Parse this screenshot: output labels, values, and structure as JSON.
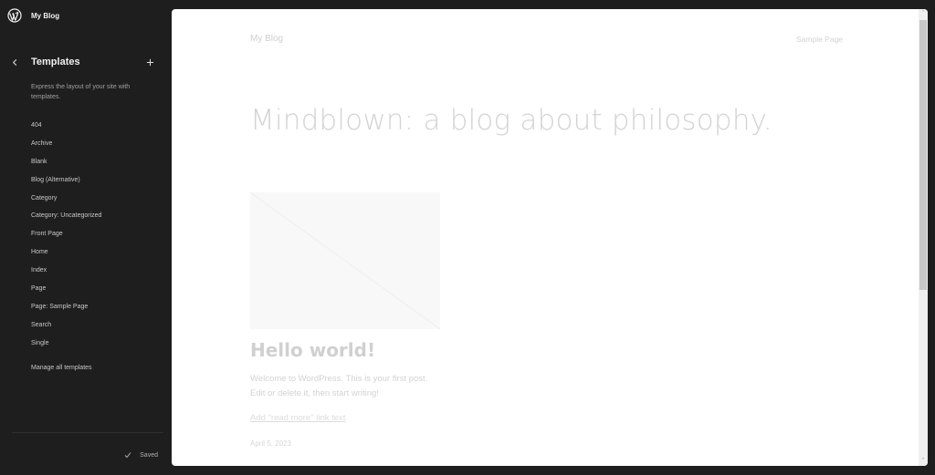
{
  "site": {
    "name": "My Blog"
  },
  "sidebar": {
    "title": "Templates",
    "back_icon": "chevron-left-icon",
    "add_icon": "plus-icon",
    "description": "Express the layout of your site with templates.",
    "templates": [
      {
        "label": "404"
      },
      {
        "label": "Archive"
      },
      {
        "label": "Blank"
      },
      {
        "label": "Blog (Alternative)"
      },
      {
        "label": "Category"
      },
      {
        "label": "Category: Uncategorized"
      },
      {
        "label": "Front Page"
      },
      {
        "label": "Home"
      },
      {
        "label": "Index"
      },
      {
        "label": "Page"
      },
      {
        "label": "Page: Sample Page"
      },
      {
        "label": "Search"
      },
      {
        "label": "Single"
      }
    ],
    "manage_label": "Manage all templates",
    "status": "Saved"
  },
  "preview": {
    "blog_title": "My Blog",
    "nav_link": "Sample Page",
    "tagline": "Mindblown: a blog about philosophy.",
    "post": {
      "title": "Hello world!",
      "excerpt": "Welcome to WordPress. This is your first post. Edit or delete it, then start writing!",
      "read_more": "Add \"read more\" link text",
      "date": "April 5, 2023"
    },
    "scroll": {
      "up_glyph": "˄",
      "down_glyph": "˅"
    }
  },
  "colors": {
    "sidebar_bg": "#1e1e1e",
    "preview_bg": "#ffffff",
    "muted_text": "#d0d0d0"
  }
}
